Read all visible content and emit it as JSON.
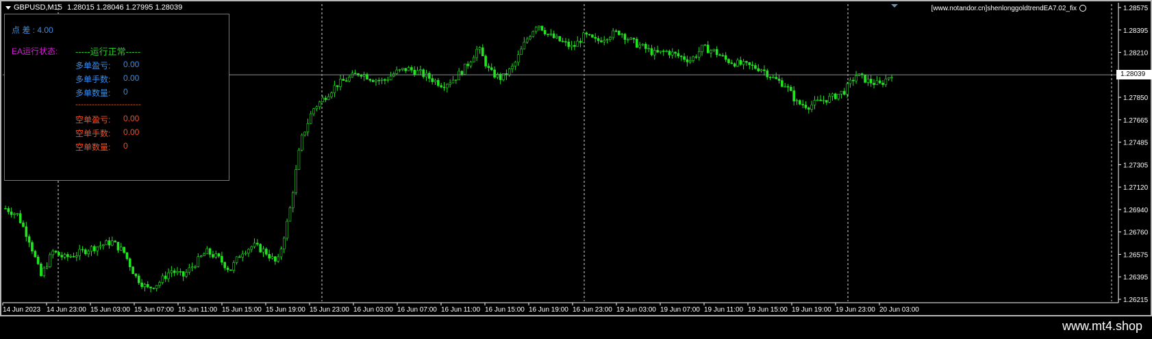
{
  "header": {
    "symbol": "GBPUSD,M15",
    "ohlc": "1.28015 1.28046 1.27995 1.28039",
    "ea_label": "[www.notandor.cn]shenlonggoldtrendEA7.02_fix"
  },
  "panel": {
    "spread_label": "点    差 : 4.00",
    "ea_status_label": "EA运行状态:",
    "ea_status_value": "-----运行正常-----",
    "long_profit_label": "多单盈亏:",
    "long_profit_value": "0.00",
    "long_lots_label": "多单手数:",
    "long_lots_value": "0.00",
    "long_count_label": "多单数量:",
    "long_count_value": "0",
    "divider": "------------------------",
    "short_profit_label": "空单盈亏:",
    "short_profit_value": "0.00",
    "short_lots_label": "空单手数:",
    "short_lots_value": "0.00",
    "short_count_label": "空单数量:",
    "short_count_value": "0"
  },
  "price_axis": {
    "ticks": [
      "1.28575",
      "1.28395",
      "1.28210",
      "1.28039",
      "1.27850",
      "1.27665",
      "1.27485",
      "1.27305",
      "1.27120",
      "1.26940",
      "1.26760",
      "1.26575",
      "1.26395",
      "1.26215"
    ],
    "current": "1.28039"
  },
  "time_axis": {
    "labels": [
      "14 Jun 2023",
      "14 Jun 23:00",
      "15 Jun 03:00",
      "15 Jun 07:00",
      "15 Jun 11:00",
      "15 Jun 15:00",
      "15 Jun 19:00",
      "15 Jun 23:00",
      "16 Jun 03:00",
      "16 Jun 07:00",
      "16 Jun 11:00",
      "16 Jun 15:00",
      "16 Jun 19:00",
      "16 Jun 23:00",
      "19 Jun 03:00",
      "19 Jun 07:00",
      "19 Jun 11:00",
      "19 Jun 15:00",
      "19 Jun 19:00",
      "19 Jun 23:00",
      "20 Jun 03:00"
    ]
  },
  "chart_data": {
    "type": "line",
    "title": "",
    "xlabel": "",
    "ylabel": "",
    "ylim": [
      1.26215,
      1.28575
    ],
    "series": [
      {
        "values": [
          1.2695,
          1.269,
          1.267,
          1.264,
          1.266,
          1.2655,
          1.2658,
          1.2662,
          1.2665,
          1.2668,
          1.266,
          1.264,
          1.263,
          1.2635,
          1.2645,
          1.264,
          1.265,
          1.266,
          1.2655,
          1.2645,
          1.266,
          1.2665,
          1.266,
          1.265,
          1.269,
          1.275,
          1.2775,
          1.2785,
          1.2795,
          1.28,
          1.2805,
          1.28,
          1.2798,
          1.2805,
          1.2808,
          1.2805,
          1.28,
          1.2795,
          1.28,
          1.281,
          1.2825,
          1.2805,
          1.28,
          1.281,
          1.283,
          1.2845,
          1.2835,
          1.283,
          1.2825,
          1.2835,
          1.283,
          1.2835,
          1.2838,
          1.283,
          1.2825,
          1.282,
          1.2822,
          1.2818,
          1.2815,
          1.2825,
          1.2822,
          1.2815,
          1.2812,
          1.281,
          1.2808,
          1.28,
          1.2795,
          1.278,
          1.2778,
          1.2782,
          1.2785,
          1.279,
          1.2803,
          1.2798,
          1.2795,
          1.2804
        ]
      }
    ]
  },
  "footer": {
    "watermark": "www.mt4.shop"
  }
}
